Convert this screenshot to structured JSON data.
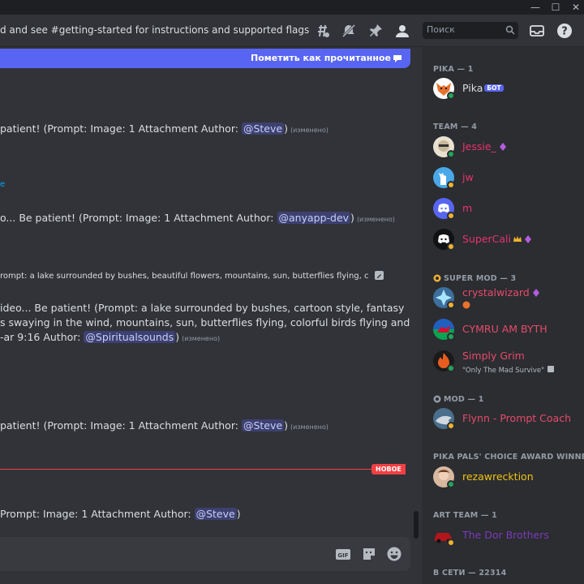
{
  "window": {
    "controls": [
      "—",
      "☐",
      "✕"
    ]
  },
  "header": {
    "topic": "d and see #getting-started for instructions and supported flags",
    "search_placeholder": "Поиск"
  },
  "banner": {
    "label": "Пометить как прочитанное"
  },
  "messages": [
    {
      "pre": "patient! (Prompt:   Image: 1 Attachment  Author: ",
      "mention": "@Steve",
      "edited": "(изменено)"
    },
    {
      "link": "e"
    },
    {
      "pre": "o... Be patient! (Prompt:   Image: 1 Attachment  Author: ",
      "mention": "@anyapp-dev",
      "edited": "(изменено)"
    },
    {
      "pre": "rompt: a lake surrounded by bushes, beautiful flowers, mountains, sun, butterflies flying, c"
    },
    {
      "line1": "ideo... Be patient! (Prompt: a lake surrounded by bushes, cartoon style, fantasy",
      "line2": "s swaying in the wind, mountains, sun, butterflies flying, colorful birds flying and",
      "line3pre": "-ar 9:16  Author: ",
      "mention": "@Spiritualsounds",
      "edited": "(изменено)"
    },
    {
      "pre": "patient! (Prompt:   Image: 1 Attachment  Author: ",
      "mention": "@Steve",
      "edited": "(изменено)"
    },
    {
      "pre": "Prompt:   Image: 1 Attachment  Author: ",
      "mention": "@Steve",
      "post": ")"
    }
  ],
  "new_divider": {
    "label": "НОВОЕ"
  },
  "colors": {
    "accent": "#5865f2",
    "online": "#23a55a",
    "idle": "#f0b232",
    "new_red": "#f23f43",
    "team_role": "#e8336b",
    "crystal_role": "#e84a6a",
    "mod_role": "#e84a6a",
    "pals_role": "#f1c40f",
    "art_role": "#7a3bb8"
  },
  "members": {
    "categories": [
      {
        "label": "PIKA — 1"
      },
      {
        "label": "TEAM — 4"
      },
      {
        "label": "SUPER MOD — 3"
      },
      {
        "label": "MOD — 1"
      },
      {
        "label": "PIKA PALS' CHOICE AWARD WINNE..."
      },
      {
        "label": "ART TEAM — 1"
      },
      {
        "label": "В СЕТИ — 22314"
      }
    ],
    "list": [
      {
        "name": "Pika",
        "badge": "БОТ",
        "status": "online"
      },
      {
        "name": "Jessie_",
        "status": "online"
      },
      {
        "name": "jw",
        "status": "idle"
      },
      {
        "name": "m",
        "status": "idle"
      },
      {
        "name": "SuperCali",
        "status": "idle"
      },
      {
        "name": "crystalwizard",
        "status": "idle"
      },
      {
        "name": "CYMRU AM BYTH",
        "status": "online"
      },
      {
        "name": "Simply Grim",
        "sub": "\"Only The Mad Survive\"",
        "status": "online"
      },
      {
        "name": "Flynn - Prompt Coach",
        "status": "idle"
      },
      {
        "name": "rezawrecktion",
        "status": "online"
      },
      {
        "name": "The Dor Brothers",
        "status": "idle"
      }
    ]
  }
}
